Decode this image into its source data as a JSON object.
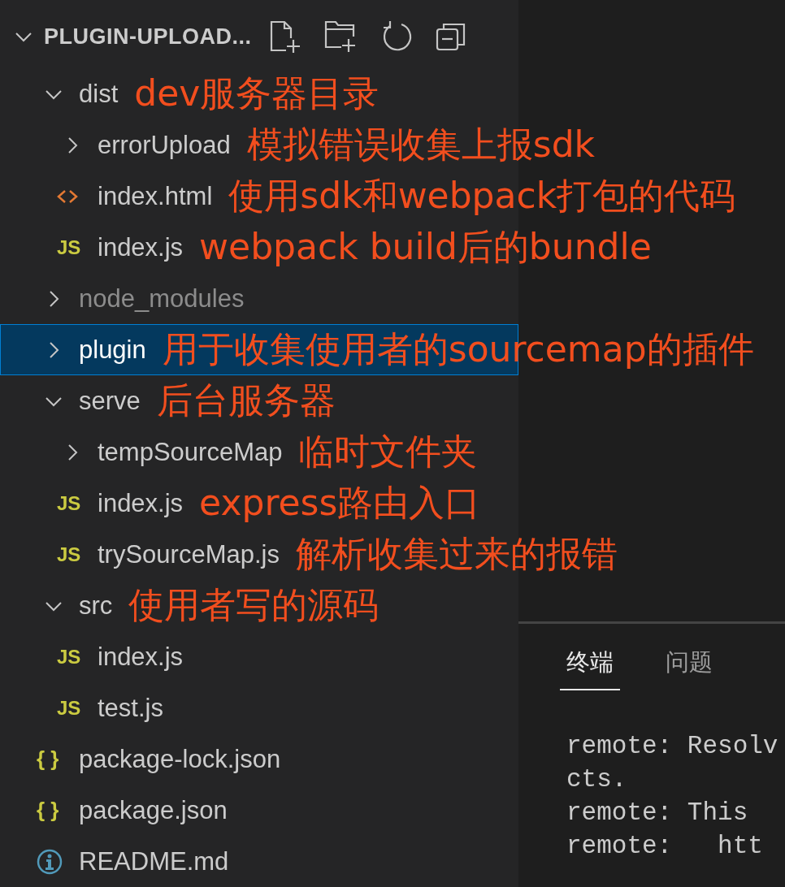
{
  "explorer": {
    "title": "PLUGIN-UPLOAD...",
    "expanded": true,
    "tree": [
      {
        "name": "dist",
        "kind": "folder",
        "expanded": true,
        "selected": false,
        "ignored": false,
        "note": "dev服务器目录",
        "children": [
          {
            "name": "errorUpload",
            "kind": "folder",
            "expanded": false,
            "selected": false,
            "ignored": false,
            "note": "模拟错误收集上报sdk"
          },
          {
            "name": "index.html",
            "kind": "html",
            "selected": false,
            "ignored": false,
            "note": "使用sdk和webpack打包的代码"
          },
          {
            "name": "index.js",
            "kind": "js",
            "icon_text": "JS",
            "selected": false,
            "ignored": false,
            "note": "webpack build后的bundle"
          }
        ]
      },
      {
        "name": "node_modules",
        "kind": "folder",
        "expanded": false,
        "selected": false,
        "ignored": true
      },
      {
        "name": "plugin",
        "kind": "folder",
        "expanded": false,
        "selected": true,
        "ignored": false,
        "note": "用于收集使用者的sourcemap的插件"
      },
      {
        "name": "serve",
        "kind": "folder",
        "expanded": true,
        "selected": false,
        "ignored": false,
        "note": "后台服务器",
        "children": [
          {
            "name": "tempSourceMap",
            "kind": "folder",
            "expanded": false,
            "selected": false,
            "ignored": false,
            "note": "临时文件夹"
          },
          {
            "name": "index.js",
            "kind": "js",
            "icon_text": "JS",
            "selected": false,
            "ignored": false,
            "note": "express路由入口"
          },
          {
            "name": "trySourceMap.js",
            "kind": "js",
            "icon_text": "JS",
            "selected": false,
            "ignored": false,
            "note": "解析收集过来的报错"
          }
        ]
      },
      {
        "name": "src",
        "kind": "folder",
        "expanded": true,
        "selected": false,
        "ignored": false,
        "note": "使用者写的源码",
        "children": [
          {
            "name": "index.js",
            "kind": "js",
            "icon_text": "JS",
            "selected": false,
            "ignored": false
          },
          {
            "name": "test.js",
            "kind": "js",
            "icon_text": "JS",
            "selected": false,
            "ignored": false
          }
        ]
      },
      {
        "name": "package-lock.json",
        "kind": "json",
        "icon_text": "{ }",
        "selected": false,
        "ignored": false
      },
      {
        "name": "package.json",
        "kind": "json",
        "icon_text": "{ }",
        "selected": false,
        "ignored": false
      },
      {
        "name": "README.md",
        "kind": "info",
        "selected": false,
        "ignored": false
      }
    ]
  },
  "panel": {
    "tabs": [
      {
        "label": "终端",
        "selected": true
      },
      {
        "label": "问题",
        "selected": false
      }
    ],
    "terminal_lines": [
      "remote: Resolv",
      "cts.",
      "remote: This",
      "remote:   htt"
    ]
  }
}
